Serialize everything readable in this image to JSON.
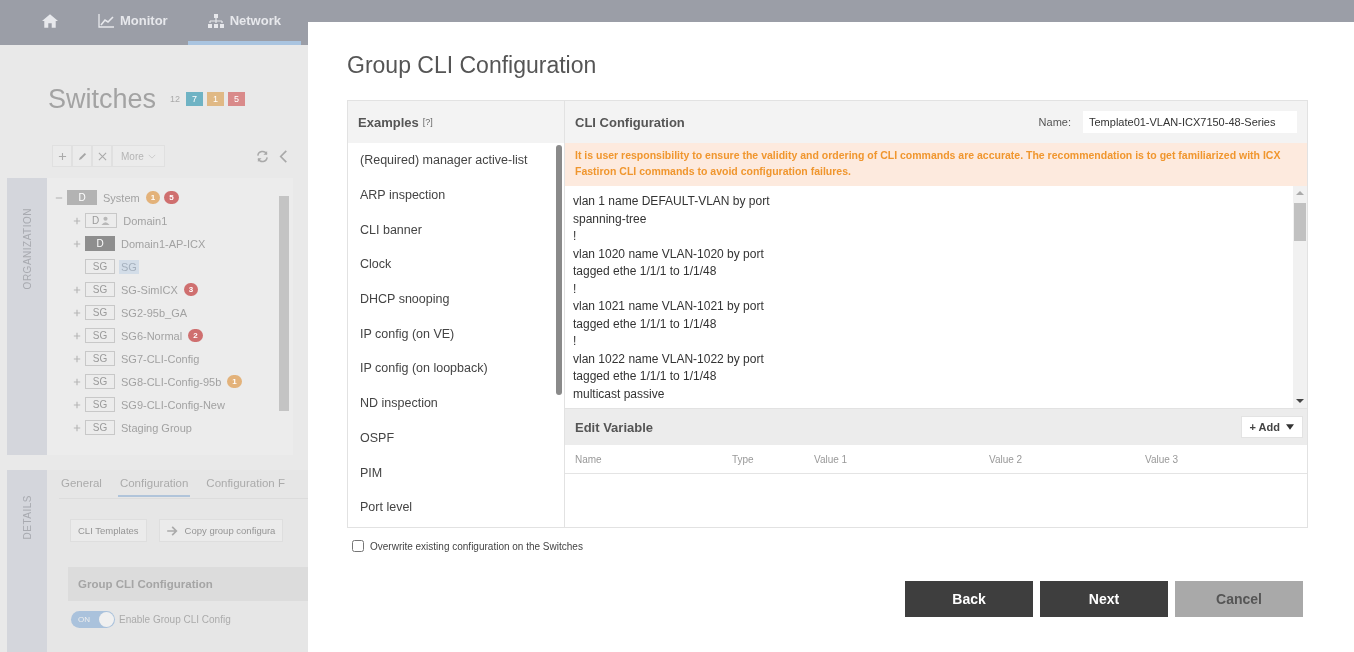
{
  "top_nav": {
    "items": [
      {
        "kind": "home",
        "selected": false
      },
      {
        "kind": "monitor",
        "label": "Monitor",
        "selected": false
      },
      {
        "kind": "network",
        "label": "Network",
        "selected": true
      }
    ]
  },
  "page": {
    "title": "Switches",
    "total": "12",
    "status_counts": [
      {
        "value": "7",
        "color": "#6fb3c4"
      },
      {
        "value": "1",
        "color": "#e0b985"
      },
      {
        "value": "5",
        "color": "#d98a8a"
      }
    ],
    "toolbar": {
      "more_label": "More"
    },
    "side_tab": "ORGANIZATION",
    "tree": [
      {
        "label": "System",
        "tag": "D",
        "kind": "filled",
        "expanded": true,
        "selected": false,
        "counts": [
          {
            "value": "1",
            "color": "#e3b27a"
          },
          {
            "value": "5",
            "color": "#cf6f6f"
          }
        ],
        "children": [
          {
            "label": "Domain1",
            "tag": "D",
            "kind": "outline",
            "user_icon": true,
            "expanded": false,
            "selected": false
          },
          {
            "label": "Domain1-AP-ICX",
            "tag": "D",
            "kind": "dark",
            "expanded": false,
            "selected": false
          },
          {
            "label": "SG",
            "tag": "SG",
            "kind": "outline",
            "selected": true
          },
          {
            "label": "SG-SimICX",
            "tag": "SG",
            "kind": "outline",
            "expanded": false,
            "selected": false,
            "counts": [
              {
                "value": "3",
                "color": "#cf6f6f"
              }
            ]
          },
          {
            "label": "SG2-95b_GA",
            "tag": "SG",
            "kind": "outline",
            "expanded": false,
            "selected": false
          },
          {
            "label": "SG6-Normal",
            "tag": "SG",
            "kind": "outline",
            "expanded": false,
            "selected": false,
            "counts": [
              {
                "value": "2",
                "color": "#cf6f6f"
              }
            ]
          },
          {
            "label": "SG7-CLI-Config",
            "tag": "SG",
            "kind": "outline",
            "expanded": false,
            "selected": false
          },
          {
            "label": "SG8-CLI-Config-95b",
            "tag": "SG",
            "kind": "outline",
            "expanded": false,
            "selected": false,
            "counts": [
              {
                "value": "1",
                "color": "#e3b27a"
              }
            ]
          },
          {
            "label": "SG9-CLI-Config-New",
            "tag": "SG",
            "kind": "outline",
            "expanded": false,
            "selected": false
          },
          {
            "label": "Staging Group",
            "tag": "SG",
            "kind": "outline",
            "expanded": false,
            "selected": false
          }
        ]
      }
    ],
    "details": {
      "side_tab": "DETAILS",
      "tabs": [
        {
          "label": "General",
          "selected": false
        },
        {
          "label": "Configuration",
          "selected": true
        },
        {
          "label": "Configuration F",
          "selected": false
        }
      ],
      "buttons": [
        {
          "label": "CLI Templates"
        },
        {
          "label": "Copy group configura",
          "icon": true
        }
      ],
      "section_title": "Group CLI Configuration",
      "toggle": {
        "text": "ON",
        "on": true,
        "label": "Enable Group CLI Config"
      }
    }
  },
  "dialog": {
    "title": "Group CLI Configuration",
    "examples": {
      "title": "Examples",
      "help": "[?]",
      "items": [
        "(Required) manager active-list",
        "ARP inspection",
        "CLI banner",
        "Clock",
        "DHCP snooping",
        "IP config (on VE)",
        "IP config (on loopback)",
        "ND inspection",
        "OSPF",
        "PIM",
        "Port level"
      ]
    },
    "cli": {
      "title": "CLI Configuration",
      "name_label": "Name:",
      "name_value": "Template01-VLAN-ICX7150-48-Series",
      "warning": "It is user responsibility to ensure the validity and ordering of CLI commands are accurate. The recommendation is to get familiarized with ICX Fastiron CLI commands to avoid configuration failures.",
      "lines": [
        "vlan 1 name DEFAULT-VLAN by port",
        "spanning-tree",
        "!",
        "vlan 1020 name VLAN-1020 by port",
        "tagged ethe 1/1/1 to 1/1/48",
        "!",
        "vlan 1021 name VLAN-1021 by port",
        "tagged ethe 1/1/1 to 1/1/48",
        "!",
        "vlan 1022 name VLAN-1022 by port",
        "tagged ethe 1/1/1 to 1/1/48",
        "multicast passive"
      ]
    },
    "variables": {
      "title": "Edit Variable",
      "add_label": "+ Add",
      "columns": [
        "Name",
        "Type",
        "Value 1",
        "Value 2",
        "Value 3"
      ]
    },
    "overwrite": {
      "label": "Overwrite existing configuration on the Switches",
      "checked": false
    },
    "buttons": [
      {
        "label": "Back",
        "disabled": false
      },
      {
        "label": "Next",
        "disabled": false
      },
      {
        "label": "Cancel",
        "disabled": true
      }
    ]
  }
}
